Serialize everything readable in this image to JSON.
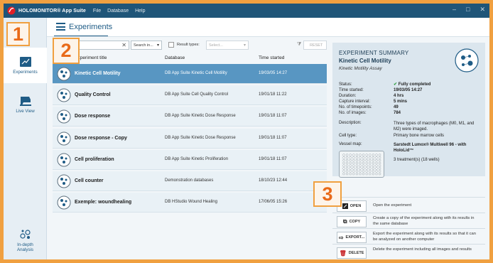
{
  "titlebar": {
    "app_name": "HOLOMONITOR® App Suite",
    "menu": [
      "File",
      "Database",
      "Help"
    ],
    "controls": [
      "–",
      "□",
      "✕"
    ]
  },
  "sidebar": {
    "items": [
      {
        "label": "Experiments",
        "icon": "chart-icon"
      },
      {
        "label": "Live View",
        "icon": "microscope-icon"
      },
      {
        "label": "In-depth\nAnalysis",
        "icon": "cells-analysis-icon"
      }
    ]
  },
  "header": {
    "title": "Experiments"
  },
  "filters": {
    "search_placeholder": "Search in...",
    "result_types_label": "Result types:",
    "result_types_placeholder": "Select...",
    "reset_label": "RESET"
  },
  "table": {
    "columns": [
      "Experiment title",
      "Database",
      "Time started"
    ],
    "rows": [
      {
        "title": "Kinetic Cell Motility",
        "database": "DB App Suite Kinetic Cell Motility",
        "time": "19/03/05 14:27",
        "selected": true
      },
      {
        "title": "Quality Control",
        "database": "DB App Suite Cell Quality Control",
        "time": "19/01/18 11:22"
      },
      {
        "title": "Dose response",
        "database": "DB App Suite Kinetic Dose Response",
        "time": "19/01/18 11:07"
      },
      {
        "title": "Dose response - Copy",
        "database": "DB App Suite Kinetic Dose Response",
        "time": "19/01/18 11:07"
      },
      {
        "title": "Cell proliferation",
        "database": "DB App Suite Kinetic Proliferation",
        "time": "19/01/18 11:07"
      },
      {
        "title": "Cell counter",
        "database": "Demonstration databases",
        "time": "18/10/23 12:44"
      },
      {
        "title": "Exemple: woundhealing",
        "database": "DB HStudio Wound Healing",
        "time": "17/06/05 15:26"
      }
    ]
  },
  "summary": {
    "heading": "EXPERIMENT SUMMARY",
    "title": "Kinetic Cell Motility",
    "assay": "Kinetic Motility Assay",
    "fields": {
      "status_label": "Status:",
      "status_value": "Fully completed",
      "time_started_label": "Time started:",
      "time_started_value": "19/03/05 14:27",
      "duration_label": "Duration:",
      "duration_value": "4 hrs",
      "capture_label": "Capture interval:",
      "capture_value": "5 mins",
      "timepoints_label": "No. of timepoints:",
      "timepoints_value": "49",
      "images_label": "No. of images:",
      "images_value": "784",
      "description_label": "Description:",
      "description_value": "Three types of macrophages (M0, M1, and M2) were imaged.",
      "celltype_label": "Cell type:",
      "celltype_value": "Primary bone marrow cells",
      "vessel_label": "Vessel map:",
      "vessel_value": "Sarstedt Lumox® Multiwell 96 - with HoloLid™",
      "treatments": "3 treatment(s) (18 wells)"
    }
  },
  "actions": [
    {
      "label": "OPEN",
      "desc": "Open the experiment"
    },
    {
      "label": "COPY",
      "desc": "Create a copy of the experiment along with its results in the same database"
    },
    {
      "label": "EXPORT...",
      "desc": "Export the experiment along with its results so that it can be analyzed on another computer"
    },
    {
      "label": "DELETE",
      "desc": "Delete the experiment including all images and results"
    }
  ],
  "callouts": [
    "1",
    "2",
    "3"
  ],
  "colors": {
    "accent": "#1f5c86",
    "titlebar": "#1f5578",
    "selected_row": "#5896c2",
    "callout": "#f0a040",
    "success": "#2e9e3c",
    "danger": "#c8282d"
  }
}
